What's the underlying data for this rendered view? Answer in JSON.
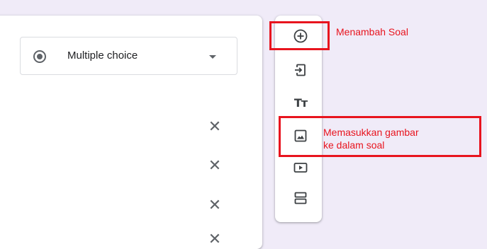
{
  "question_card": {
    "type_select": {
      "value": "Multiple choice",
      "icon": "radio-button-checked-icon",
      "arrow_icon": "dropdown-arrow-icon"
    },
    "remove_option_icon": "close-icon",
    "remove_option_glyph": "✕"
  },
  "toolbar": {
    "items": [
      {
        "name": "add-question",
        "icon": "add-circle-icon"
      },
      {
        "name": "import-questions",
        "icon": "import-icon"
      },
      {
        "name": "add-title-description",
        "icon": "text-title-icon",
        "glyph": "Tт"
      },
      {
        "name": "add-image",
        "icon": "image-icon"
      },
      {
        "name": "add-video",
        "icon": "video-icon"
      },
      {
        "name": "add-section",
        "icon": "section-icon"
      }
    ]
  },
  "annotations": {
    "add_question": "Menambah Soal",
    "add_image_line1": "Memasukkan gambar",
    "add_image_line2": "ke dalam soal",
    "color": "#e8141e"
  }
}
